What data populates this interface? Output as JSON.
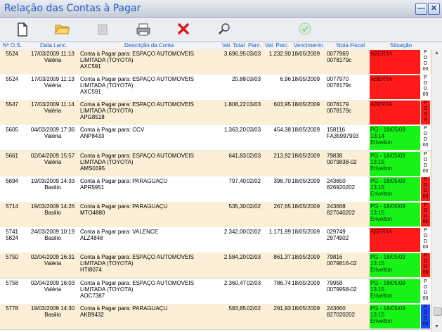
{
  "window": {
    "title": "Relação das Contas à Pagar",
    "minimize": "—",
    "close": "✕"
  },
  "toolbar": {
    "new_icon": "new-document-icon",
    "open_icon": "open-folder-icon",
    "edit_icon": "disabled-edit-icon",
    "print_icon": "printer-icon",
    "delete_icon": "delete-x-icon",
    "search_icon": "magnifier-icon",
    "confirm_icon": "checkmark-icon"
  },
  "columns": {
    "os": "Nº O.S.",
    "date": "Data Lanc.",
    "desc": "Descrição da Conta",
    "total": "Val. Total",
    "parc": "Parc.",
    "val_parc": "Val. Parc.",
    "venc": "Vencimento",
    "nf": "Nota Fiscal",
    "sit": "Situação"
  },
  "rows": [
    {
      "os1": "5524",
      "os2": "",
      "date": "17/03/2009 11:13",
      "user": "Valéria",
      "d1": "Conta à Pagar para:  ESPAÇO AUTOMOVEIS",
      "d2": "LIMITADA (TOYOTA)",
      "d3": "AXC591",
      "total": "3.696,95",
      "parc": "03/03",
      "vparc": "1.232,90",
      "venc": "18/05/2009",
      "nf1": "0077969",
      "nf2": "0078179c",
      "s1": "ABERTA",
      "s2": "",
      "s3": "",
      "status": "open",
      "pod": "w",
      "p": "P",
      "o": "O",
      "dd": "D",
      "z": "00"
    },
    {
      "os1": "5524",
      "os2": "",
      "date": "17/03/2009 11:13",
      "user": "Valéria",
      "d1": "Conta à Pagar para:  ESPAÇO AUTOMOVEIS",
      "d2": "LIMITADA (TOYOTA)",
      "d3": "AXC591",
      "total": "20,88",
      "parc": "03/03",
      "vparc": "6,96",
      "venc": "18/05/2009",
      "nf1": "0077970",
      "nf2": "0078179c",
      "s1": "ABERTA",
      "s2": "",
      "s3": "",
      "status": "open",
      "pod": "w",
      "p": "P",
      "o": "O",
      "dd": "D",
      "z": "00"
    },
    {
      "os1": "5547",
      "os2": "",
      "date": "17/03/2009 11:14",
      "user": "Valéria",
      "d1": "Conta à Pagar para:  ESPAÇO AUTOMOVEIS",
      "d2": "LIMITADA (TOYOTA)",
      "d3": "APG8518",
      "total": "1.808,22",
      "parc": "03/03",
      "vparc": "603,95",
      "venc": "18/05/2009",
      "nf1": "0078179",
      "nf2": "0078179c",
      "s1": "ABERTA",
      "s2": "",
      "s3": "",
      "status": "open",
      "pod": "r",
      "p": "P",
      "o": "O",
      "dd": "D",
      "z": "A"
    },
    {
      "os1": "5605",
      "os2": "",
      "date": "04/03/2009 17:36",
      "user": "Valéria",
      "d1": "Conta à Pagar para:  CCV",
      "d2": "ANP8433",
      "d3": "",
      "total": "1.363,20",
      "parc": "03/03",
      "vparc": "454,38",
      "venc": "18/05/2009",
      "nf1": "158116",
      "nf2": "FA35997903",
      "s1": "PG - 18/05/09",
      "s2": "13:14",
      "s3": "Erivelton",
      "status": "paid",
      "pod": "w",
      "p": "P",
      "o": "O",
      "dd": "D",
      "z": "00"
    },
    {
      "os1": "5661",
      "os2": "",
      "date": "02/04/2009 15:57",
      "user": "Valéria",
      "d1": "Conta à Pagar para:  ESPAÇO AUTOMOVEIS",
      "d2": "LIMITADA (TOYOTA)",
      "d3": "AMS0195",
      "total": "641,83",
      "parc": "02/03",
      "vparc": "213,92",
      "venc": "18/05/2009",
      "nf1": "79838",
      "nf2": "0079838-02",
      "s1": "PG - 18/05/09",
      "s2": "13:15",
      "s3": "Erivelton",
      "status": "paid",
      "pod": "w",
      "p": "P",
      "o": "O",
      "dd": "D",
      "z": "00"
    },
    {
      "os1": "5694",
      "os2": "",
      "date": "19/03/2009 14:33",
      "user": "Basilio",
      "d1": "Conta à Pagar para:  PARAGUAÇU",
      "d2": "APR5951",
      "d3": "",
      "total": "797,40",
      "parc": "02/02",
      "vparc": "398,70",
      "venc": "18/05/2009",
      "nf1": "243650",
      "nf2": "826920202",
      "s1": "PG - 18/05/09",
      "s2": "13:15",
      "s3": "Erivelton",
      "status": "paid",
      "pod": "r",
      "p": "P",
      "o": "O",
      "dd": "D",
      "z": "00"
    },
    {
      "os1": "5714",
      "os2": "",
      "date": "19/03/2009 14:26",
      "user": "Basilio",
      "d1": "Conta à Pagar para:  PARAGUAÇU",
      "d2": "MTO4880",
      "d3": "",
      "total": "535,30",
      "parc": "02/02",
      "vparc": "267,65",
      "venc": "18/05/2009",
      "nf1": "243668",
      "nf2": "827040202",
      "s1": "PG - 18/05/09",
      "s2": "13:15",
      "s3": "Erivelton",
      "status": "paid",
      "pod": "r",
      "p": "P",
      "o": "O",
      "dd": "D",
      "z": "00"
    },
    {
      "os1": "5741",
      "os2": "5824",
      "date": "24/03/2009 10:19",
      "user": "Basilio",
      "d1": "Conta à Pagar para:  VALENCE",
      "d2": "ALZ4848",
      "d3": "",
      "total": "2.342,00",
      "parc": "02/02",
      "vparc": "1.171,99",
      "venc": "18/05/2009",
      "nf1": "029749",
      "nf2": "2974902",
      "s1": "ABERTA",
      "s2": "",
      "s3": "",
      "status": "open",
      "pod": "w",
      "p": "P",
      "o": "O",
      "dd": "D",
      "z": "00"
    },
    {
      "os1": "5750",
      "os2": "",
      "date": "02/04/2009 16:31",
      "user": "Valéria",
      "d1": "Conta à Pagar para:  ESPAÇO AUTOMOVEIS",
      "d2": "LIMITADA (TOYOTA)",
      "d3": "HTI8074",
      "total": "2.584,20",
      "parc": "02/03",
      "vparc": "861,37",
      "venc": "18/05/2009",
      "nf1": "79816",
      "nf2": "0079816-02",
      "s1": "PG - 18/05/09",
      "s2": "13:15",
      "s3": "Erivelton",
      "status": "paid",
      "pod": "r",
      "p": "P",
      "o": "O",
      "dd": "D",
      "z": "00"
    },
    {
      "os1": "5758",
      "os2": "",
      "date": "02/04/2009 16:03",
      "user": "Valéria",
      "d1": "Conta à Pagar para:  ESPAÇO AUTOMOVEIS",
      "d2": "LIMITADA (TOYOTA)",
      "d3": "AOC7387",
      "total": "2.360,47",
      "parc": "02/03",
      "vparc": "786,74",
      "venc": "18/05/2009",
      "nf1": "79958",
      "nf2": "0079958-02",
      "s1": "PG - 18/05/09",
      "s2": "13:15",
      "s3": "Erivelton",
      "status": "paid",
      "pod": "w",
      "p": "P",
      "o": "O",
      "dd": "D",
      "z": "00"
    },
    {
      "os1": "5778",
      "os2": "",
      "date": "19/03/2009 14:30",
      "user": "Basilio",
      "d1": "Conta à Pagar para:  PARAGUAÇU",
      "d2": "AKB9432",
      "d3": "",
      "total": "583,85",
      "parc": "02/02",
      "vparc": "291,93",
      "venc": "18/05/2009",
      "nf1": "243660",
      "nf2": "827020202",
      "s1": "PG - 18/05/09",
      "s2": "13:15",
      "s3": "Erivelton",
      "status": "paid",
      "pod": "b",
      "p": "P",
      "o": "O",
      "dd": "D",
      "z": "00"
    }
  ]
}
